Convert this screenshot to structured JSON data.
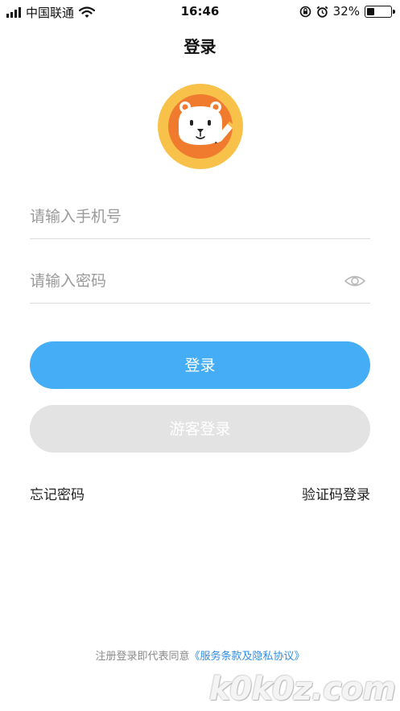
{
  "status_bar": {
    "carrier": "中国联通",
    "time": "16:46",
    "battery_percent": "32%",
    "battery_level": 0.32,
    "icons": [
      "signal-icon",
      "wifi-icon",
      "orientation-lock-icon",
      "alarm-icon",
      "battery-icon"
    ]
  },
  "header": {
    "title": "登录"
  },
  "logo": {
    "icon": "lion-pencil-logo",
    "colors": {
      "ring": "#f8c24a",
      "inner": "#f07b2f",
      "face": "#ffffff"
    }
  },
  "form": {
    "phone_placeholder": "请输入手机号",
    "password_placeholder": "请输入密码",
    "password_toggle_icon": "eye-icon"
  },
  "buttons": {
    "login": "登录",
    "guest_login": "游客登录"
  },
  "links": {
    "forgot_password": "忘记密码",
    "sms_login": "验证码登录"
  },
  "footer": {
    "agreement_prefix": "注册登录即代表同意",
    "agreement_link": "《服务条款及隐私协议》"
  },
  "watermark": {
    "text": "k0k0z.com"
  },
  "colors": {
    "primary": "#44adf6",
    "disabled": "#e3e3e3",
    "link": "#2f8de4"
  }
}
